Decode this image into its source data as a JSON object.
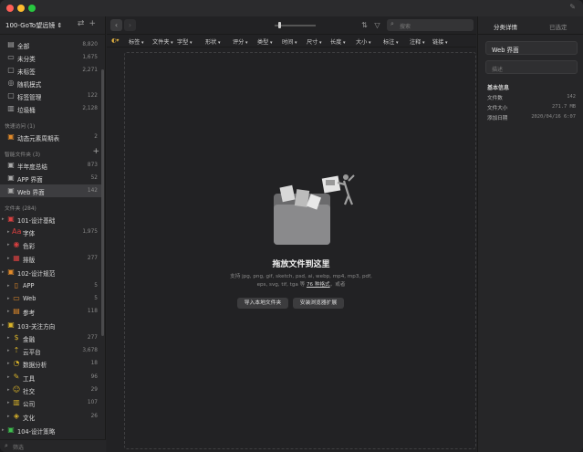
{
  "window": {
    "pin_icon": "pin-icon"
  },
  "sidebar": {
    "library_name": "100-GoTo望远镜 ⇕",
    "top_items": [
      {
        "label": "全部",
        "count": "8,820",
        "icon": "all-icon"
      },
      {
        "label": "未分类",
        "count": "1,675",
        "icon": "inbox-icon"
      },
      {
        "label": "未标签",
        "count": "2,271",
        "icon": "untagged-icon"
      },
      {
        "label": "随机模式",
        "count": "",
        "icon": "random-icon"
      },
      {
        "label": "标签管理",
        "count": "122",
        "icon": "tag-icon"
      },
      {
        "label": "垃圾桶",
        "count": "2,128",
        "icon": "trash-icon"
      }
    ],
    "quick_access_title": "快速访问 (1)",
    "quick_access": [
      {
        "label": "动态元素周期表",
        "count": "2"
      }
    ],
    "smart_title": "智能文件夹 (3)",
    "smart_folders": [
      {
        "label": "半年度总结",
        "count": "873"
      },
      {
        "label": "APP 界面",
        "count": "52"
      },
      {
        "label": "Web 界面",
        "count": "142"
      }
    ],
    "folders_title": "文件夹 (284)",
    "folders": [
      {
        "label": "101-设计基础",
        "count": "",
        "level": 0,
        "color": "#d94040",
        "icon": "folder-icon"
      },
      {
        "label": "字体",
        "count": "1,975",
        "level": 1,
        "color": "#d94040",
        "icon": "font-icon"
      },
      {
        "label": "色彩",
        "count": "",
        "level": 1,
        "color": "#d94040",
        "icon": "palette-icon"
      },
      {
        "label": "排版",
        "count": "277",
        "level": 1,
        "color": "#d94040",
        "icon": "layout-icon"
      },
      {
        "label": "102-设计规范",
        "count": "",
        "level": 0,
        "color": "#e08a2a",
        "icon": "folder-icon"
      },
      {
        "label": "APP",
        "count": "5",
        "level": 1,
        "color": "#e08a2a",
        "icon": "phone-icon"
      },
      {
        "label": "Web",
        "count": "5",
        "level": 1,
        "color": "#e08a2a",
        "icon": "web-icon"
      },
      {
        "label": "参考",
        "count": "118",
        "level": 1,
        "color": "#e08a2a",
        "icon": "book-icon"
      },
      {
        "label": "103-关注方向",
        "count": "",
        "level": 0,
        "color": "#d8b22a",
        "icon": "folder-icon"
      },
      {
        "label": "金融",
        "count": "277",
        "level": 1,
        "color": "#d8b22a",
        "icon": "money-icon"
      },
      {
        "label": "云平台",
        "count": "3,678",
        "level": 1,
        "color": "#d8b22a",
        "icon": "cloud-icon"
      },
      {
        "label": "数据分析",
        "count": "18",
        "level": 1,
        "color": "#d8b22a",
        "icon": "chart-icon"
      },
      {
        "label": "工具",
        "count": "96",
        "level": 1,
        "color": "#d8b22a",
        "icon": "tool-icon"
      },
      {
        "label": "社交",
        "count": "29",
        "level": 1,
        "color": "#d8b22a",
        "icon": "people-icon"
      },
      {
        "label": "公司",
        "count": "107",
        "level": 1,
        "color": "#d8b22a",
        "icon": "building-icon"
      },
      {
        "label": "文化",
        "count": "26",
        "level": 1,
        "color": "#d8b22a",
        "icon": "culture-icon"
      },
      {
        "label": "104-设计策略",
        "count": "",
        "level": 0,
        "color": "#3fbf4f",
        "icon": "folder-icon"
      }
    ],
    "filter_placeholder": "筛选"
  },
  "toolbar": {
    "search_placeholder": "搜索"
  },
  "filters": [
    "标签",
    "文件夹",
    "字型",
    "形状",
    "评分",
    "类型",
    "时间",
    "尺寸",
    "长度",
    "大小",
    "标注",
    "注释",
    "链接"
  ],
  "dropzone": {
    "title": "拖放文件到这里",
    "desc_before": "支持 jpg, png, gif, sketch, psd, ai, webp, mp4, mp3, pdf, eps, svg, tif, tga 等 ",
    "desc_link": "76 种格式",
    "desc_after": "，或者",
    "btn_import": "导入本地文件夹",
    "btn_extension": "安装浏览器扩展"
  },
  "panel": {
    "tab_details": "分类详情",
    "tab_selected": "已选定",
    "name_value": "Web 界面",
    "desc_placeholder": "描述",
    "section_title": "基本信息",
    "rows": [
      {
        "key": "文件数",
        "value": "142"
      },
      {
        "key": "文件大小",
        "value": "271.7 MB"
      },
      {
        "key": "添加日期",
        "value": "2020/04/16 6:07"
      }
    ]
  }
}
